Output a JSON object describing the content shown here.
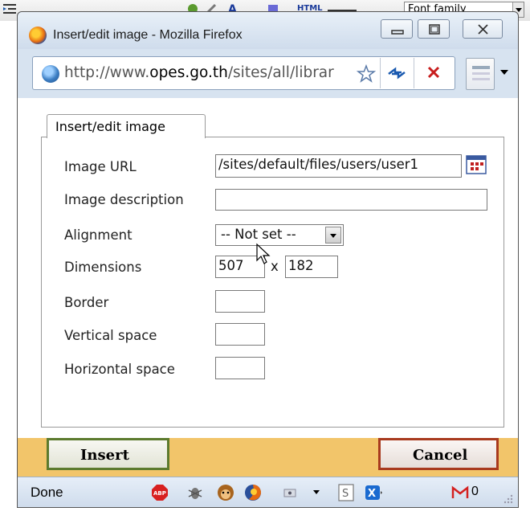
{
  "background_toolbar": {
    "font_family_label": "Font family",
    "html_label": "HTML"
  },
  "window": {
    "title": "Insert/edit image - Mozilla Firefox",
    "controls": [
      "minimize",
      "maximize",
      "close"
    ]
  },
  "url_bar": {
    "url_prefix": "http://www.",
    "url_domain": "opes.go.th",
    "url_rest": "/sites/all/librar"
  },
  "dialog": {
    "tab_label": "Insert/edit image",
    "fields": {
      "image_url": {
        "label": "Image URL",
        "value": "/sites/default/files/users/user1"
      },
      "image_description": {
        "label": "Image description",
        "value": ""
      },
      "alignment": {
        "label": "Alignment",
        "value": "-- Not set --"
      },
      "dimensions": {
        "label": "Dimensions",
        "width": "507",
        "separator": "x",
        "height": "182"
      },
      "border": {
        "label": "Border",
        "value": ""
      },
      "vertical_space": {
        "label": "Vertical space",
        "value": ""
      },
      "horizontal_space": {
        "label": "Horizontal space",
        "value": ""
      }
    },
    "insert_label": "Insert",
    "cancel_label": "Cancel"
  },
  "status_bar": {
    "status": "Done",
    "gmail_count": "0",
    "icons": [
      "adblock-icon",
      "firebug-icon",
      "greasemonkey-icon",
      "firefox-icon",
      "screen-icon",
      "s-icon",
      "x-icon",
      "gmail-icon"
    ]
  },
  "colors": {
    "insert_border": "#5c7a2e",
    "cancel_border": "#a83a1e",
    "page_band": "#f2c56a"
  }
}
